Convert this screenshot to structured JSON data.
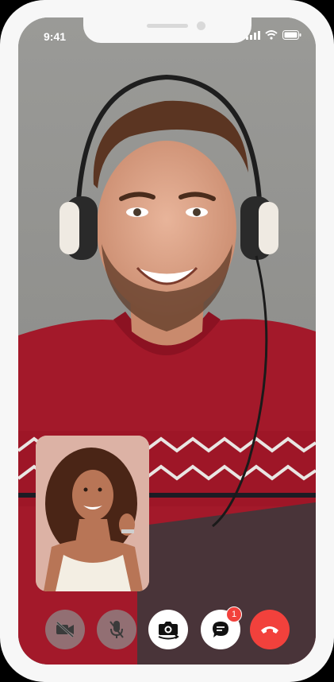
{
  "status_bar": {
    "time": "9:41"
  },
  "controls": {
    "camera_off": "video-off-icon",
    "mute": "mic-off-icon",
    "flip_camera": "flip-camera-icon",
    "chat": "chat-icon",
    "chat_badge": "1",
    "end_call": "end-call-icon"
  },
  "colors": {
    "end_call": "#f2413c",
    "badge": "#f2413c"
  }
}
